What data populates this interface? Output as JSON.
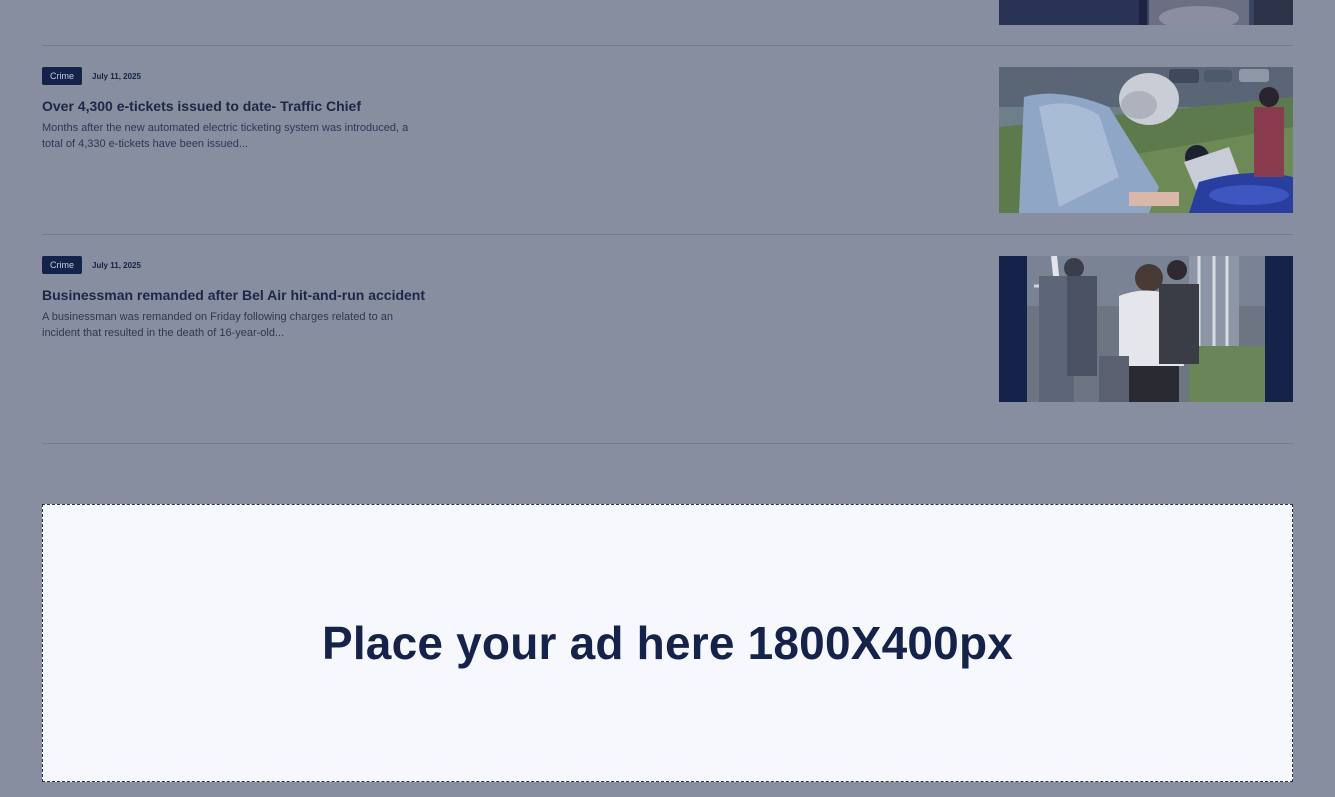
{
  "articles": [
    {
      "category": "Crime",
      "date": "July 11, 2025",
      "title": "Over 4,300 e-tickets issued to date- Traffic Chief",
      "excerpt": "Months after the new automated electric ticketing system was introduced, a total of 4,330 e-tickets have been issued..."
    },
    {
      "category": "Crime",
      "date": "July 11, 2025",
      "title": "Businessman remanded after Bel Air hit-and-run accident",
      "excerpt": "A businessman was remanded on Friday following charges related to an incident that resulted in the death of 16-year-old..."
    }
  ],
  "ad": {
    "text": "Place your ad here 1800X400px"
  }
}
